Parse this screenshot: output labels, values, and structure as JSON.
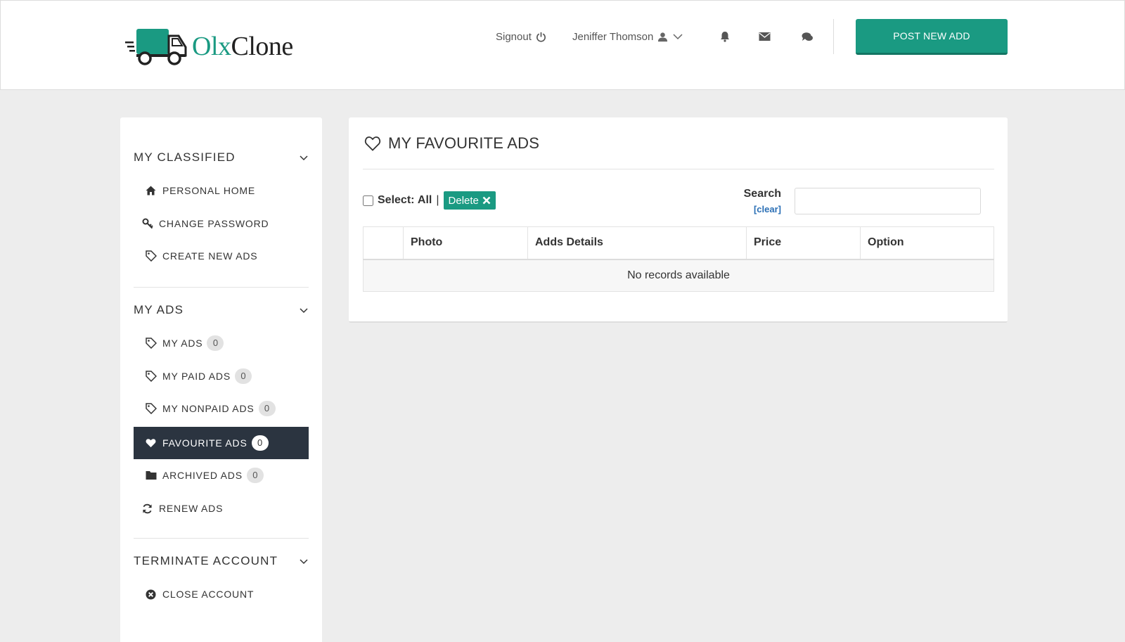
{
  "header": {
    "logo": {
      "part1": "Olx",
      "part2": "Clone"
    },
    "signout_label": "Signout",
    "user_name": "Jeniffer Thomson",
    "post_button": "POST NEW ADD"
  },
  "sidebar": {
    "sections": [
      {
        "title": "MY CLASSIFIED"
      },
      {
        "title": "MY ADS"
      },
      {
        "title": "TERMINATE ACCOUNT"
      }
    ],
    "items": [
      {
        "label": "PERSONAL HOME",
        "icon": "home-icon"
      },
      {
        "label": "CHANGE PASSWORD",
        "icon": "key-icon"
      },
      {
        "label": "CREATE NEW ADS",
        "icon": "tag-icon"
      },
      {
        "label": "MY ADS",
        "icon": "tag-icon",
        "count": "0"
      },
      {
        "label": "MY PAID ADS",
        "icon": "tag-icon",
        "count": "0"
      },
      {
        "label": "MY NONPAID ADS",
        "icon": "tag-icon",
        "count": "0"
      },
      {
        "label": "FAVOURITE ADS",
        "icon": "heart-icon",
        "count": "0",
        "active": true
      },
      {
        "label": "ARCHIVED ADS",
        "icon": "folder-icon",
        "count": "0"
      },
      {
        "label": "RENEW ADS",
        "icon": "refresh-icon"
      },
      {
        "label": "CLOSE ACCOUNT",
        "icon": "close-circle-icon"
      }
    ]
  },
  "main": {
    "title": "MY FAVOURITE ADS",
    "select_label": "Select:",
    "select_all": "All",
    "pipe": "|",
    "delete_label": "Delete",
    "search_label": "Search",
    "clear_label": "[clear]",
    "search_value": "",
    "table": {
      "columns": [
        "",
        "Photo",
        "Adds Details",
        "Price",
        "Option"
      ],
      "empty_message": "No records available"
    }
  },
  "colors": {
    "accent": "#1a9a82",
    "active_item_bg": "#2b3440",
    "page_bg": "#ededed",
    "link": "#2a6fb5"
  }
}
